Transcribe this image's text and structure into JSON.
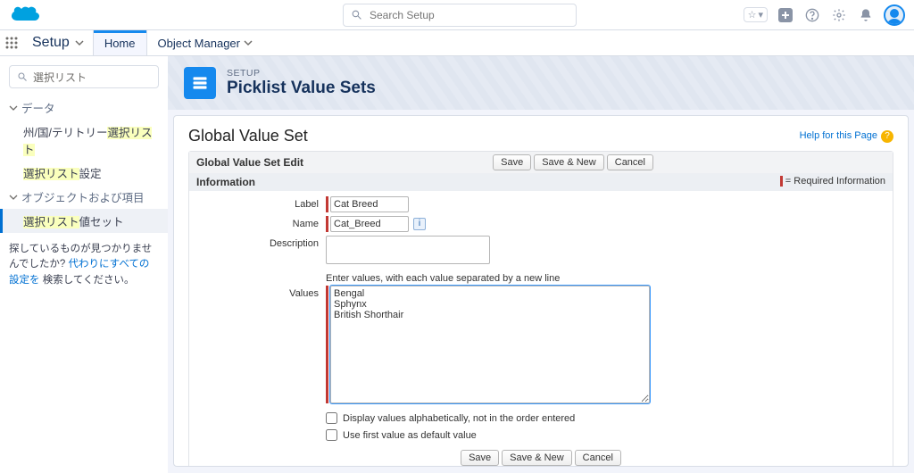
{
  "search": {
    "placeholder": "Search Setup"
  },
  "app": {
    "name": "Setup"
  },
  "tabs": [
    {
      "id": "home",
      "label": "Home",
      "active": true
    },
    {
      "id": "objmgr",
      "label": "Object Manager",
      "active": false
    }
  ],
  "side": {
    "filter_text": "選択リスト",
    "cat1": "データ",
    "cat1_items": [
      {
        "pre": "州/国/テリトリー",
        "hl": "選択リスト"
      },
      {
        "hl": "選択リスト",
        "post": "設定"
      }
    ],
    "cat2": "オブジェクトおよび項目",
    "cat2_items": [
      {
        "hl": "選択リスト",
        "post": "値セット",
        "selected": true
      }
    ],
    "help_pre": "探しているものが見つかりませんでしたか? ",
    "help_link": "代わりにすべての設定を",
    "help_post": " 検索してください。"
  },
  "page": {
    "eyebrow": "SETUP",
    "title": "Picklist Value Sets",
    "card_title": "Global Value Set",
    "help_link": "Help for this Page",
    "block_title": "Global Value Set Edit",
    "section_title": "Information",
    "req_note": "= Required Information",
    "buttons": {
      "save": "Save",
      "save_new": "Save & New",
      "cancel": "Cancel"
    }
  },
  "form": {
    "label_lbl": "Label",
    "label_val": "Cat Breed",
    "name_lbl": "Name",
    "name_val": "Cat_Breed",
    "desc_lbl": "Description",
    "values_lbl": "Values",
    "values_help": "Enter values, with each value separated by a new line",
    "values_val": "Bengal\nSphynx\nBritish Shorthair",
    "sort_alpha": "Display values alphabetically, not in the order entered",
    "first_default": "Use first value as default value"
  }
}
